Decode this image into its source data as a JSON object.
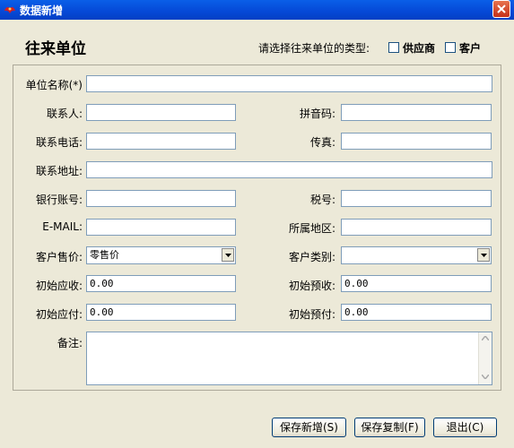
{
  "window": {
    "title": "数据新增"
  },
  "header": {
    "title": "往来单位",
    "type_prompt": "请选择往来单位的类型:",
    "types": [
      {
        "label": "供应商",
        "checked": false
      },
      {
        "label": "客户",
        "checked": false
      }
    ]
  },
  "form": {
    "unit_name": {
      "label": "单位名称(*)",
      "value": ""
    },
    "contact": {
      "label": "联系人:",
      "value": ""
    },
    "pinyin": {
      "label": "拼音码:",
      "value": ""
    },
    "phone": {
      "label": "联系电话:",
      "value": ""
    },
    "fax": {
      "label": "传真:",
      "value": ""
    },
    "address": {
      "label": "联系地址:",
      "value": ""
    },
    "bank_account": {
      "label": "银行账号:",
      "value": ""
    },
    "tax_no": {
      "label": "税号:",
      "value": ""
    },
    "email": {
      "label": "E-MAIL:",
      "value": ""
    },
    "region": {
      "label": "所属地区:",
      "value": ""
    },
    "sale_price": {
      "label": "客户售价:",
      "value": "零售价"
    },
    "customer_category": {
      "label": "客户类别:",
      "value": ""
    },
    "initial_receivable": {
      "label": "初始应收:",
      "value": "0.00"
    },
    "initial_prereceived": {
      "label": "初始预收:",
      "value": "0.00"
    },
    "initial_payable": {
      "label": "初始应付:",
      "value": "0.00"
    },
    "initial_prepaid": {
      "label": "初始预付:",
      "value": "0.00"
    },
    "remarks": {
      "label": "备注:",
      "value": ""
    }
  },
  "buttons": {
    "save_new": "保存新增(S)",
    "save_copy": "保存复制(F)",
    "exit": "退出(C)"
  },
  "colors": {
    "titlebar": "#0548d6",
    "window_bg": "#ece9d8",
    "input_border": "#7f9db9"
  }
}
